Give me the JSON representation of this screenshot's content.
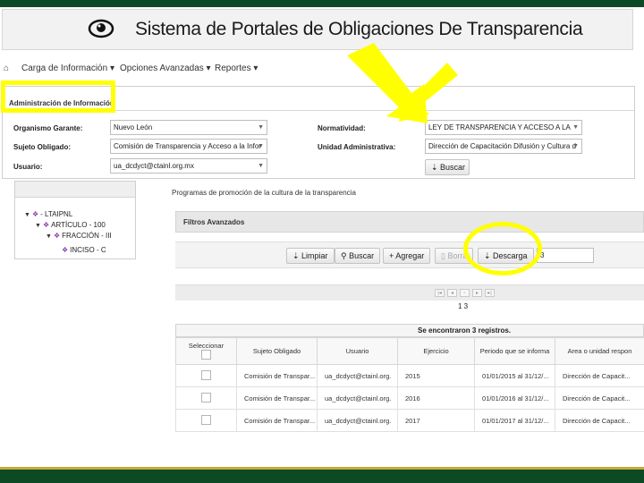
{
  "header": {
    "title": "Sistema de Portales de Obligaciones De Transparencia",
    "icon": "eye-icon"
  },
  "nav": {
    "home_icon": "home-icon",
    "items": [
      {
        "label": "Carga de Información ▾"
      },
      {
        "label": "Opciones Avanzadas ▾"
      },
      {
        "label": "Reportes ▾"
      }
    ]
  },
  "admin": {
    "title": "Administración de Información",
    "organismo_label": "Organismo Garante:",
    "organismo_value": "Nuevo León",
    "sujeto_label": "Sujeto Obligado:",
    "sujeto_value": "Comisión de Transparencia y Acceso a la Infor",
    "usuario_label": "Usuario:",
    "usuario_value": "ua_dcdyct@ctainl.org.mx",
    "normatividad_label": "Normatividad:",
    "normatividad_value": "LEY DE TRANSPARENCIA Y ACCESO A LA",
    "unidad_label": "Unidad Administrativa:",
    "unidad_value": "Dirección de Capacitación Difusión y Cultura d",
    "buscar_label": "Buscar"
  },
  "tree": [
    {
      "label": "- LTAIPNL"
    },
    {
      "label": "ARTÍCULO - 100"
    },
    {
      "label": "FRACCIÓN - III"
    },
    {
      "label": "INCISO - C"
    }
  ],
  "section_title": "Programas de promoción de la cultura de la transparencia",
  "filter_title": "Filtros Avanzados",
  "toolbar": {
    "limpiar": "Limpiar",
    "buscar": "Buscar",
    "agregar": "Agregar",
    "borrar": "Borra",
    "descarga": "Descarga",
    "count_value": "3"
  },
  "pages_text": "1 3",
  "results_text": "Se encontraron 3 registros.",
  "table": {
    "columns": [
      "Seleccionar",
      "Sujeto Obligado",
      "Usuario",
      "Ejercicio",
      "Periodo que se informa",
      "Area o unidad respon"
    ],
    "rows": [
      [
        "Comisión de Transpar...",
        "ua_dcdyct@ctainl.org.",
        "2015",
        "01/01/2015 al 31/12/...",
        "Dirección de Capacit..."
      ],
      [
        "Comisión de Transpar...",
        "ua_dcdyct@ctainl.org.",
        "2016",
        "01/01/2016 al 31/12/...",
        "Dirección de Capacit..."
      ],
      [
        "Comisión de Transpar...",
        "ua_dcdyct@ctainl.org.",
        "2017",
        "01/01/2017 al 31/12/...",
        "Dirección de Capacit..."
      ]
    ]
  },
  "colors": {
    "frame": "#0c4a26",
    "highlight": "#ffff00",
    "gold": "#c8a83a"
  }
}
